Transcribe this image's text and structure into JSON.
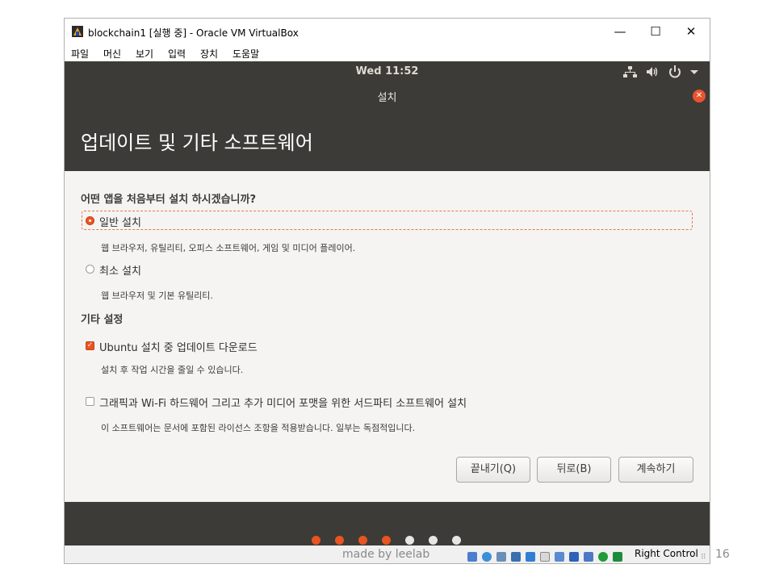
{
  "window": {
    "title": "blockchain1 [실행 중] - Oracle VM VirtualBox",
    "minimize": "—",
    "maximize": "☐",
    "close": "✕"
  },
  "menu": [
    "파일",
    "머신",
    "보기",
    "입력",
    "장치",
    "도움말"
  ],
  "topbar": {
    "clock": "Wed 11:52",
    "icons": [
      "network-icon",
      "volume-icon",
      "power-icon",
      "dropdown-arrow-icon"
    ]
  },
  "installer": {
    "title": "설치",
    "heading": "업데이트 및 기타 소프트웨어",
    "question": "어떤 앱을 처음부터 설치 하시겠습니까?",
    "options": [
      {
        "label": "일반 설치",
        "desc": "웹 브라우저, 유틸리티, 오피스  소프트웨어, 게임 및 미디어 플레이어.",
        "selected": true
      },
      {
        "label": "최소 설치",
        "desc": "웹 브라우저 및 기본 유틸리티.",
        "selected": false
      }
    ],
    "other_heading": "기타 설정",
    "checks": [
      {
        "label": "Ubuntu 설치 중 업데이트 다운로드",
        "desc": "설치 후 작업 시간을 줄일 수 있습니다.",
        "checked": true
      },
      {
        "label": "그래픽과 Wi-Fi 하드웨어 그리고 추가 미디어 포맷을 위한 서드파티 소프트웨어 설치",
        "desc": "이 소프트웨어는 문서에 포함된 라이선스 조항을 적용받습니다. 일부는 독점적입니다.",
        "checked": false
      }
    ],
    "buttons": {
      "quit": "끝내기(Q)",
      "back": "뒤로(B)",
      "continue": "계속하기"
    },
    "progress_steps": {
      "completed": 4,
      "total": 7
    }
  },
  "statusbar": {
    "host_key": "Right Control"
  },
  "overlay": {
    "watermark": "made by leelab",
    "page_number": "16"
  },
  "colors": {
    "accent": "#e95420",
    "aubergine_dark": "#3c3b37",
    "dot_inactive": "#e6e6e6"
  }
}
